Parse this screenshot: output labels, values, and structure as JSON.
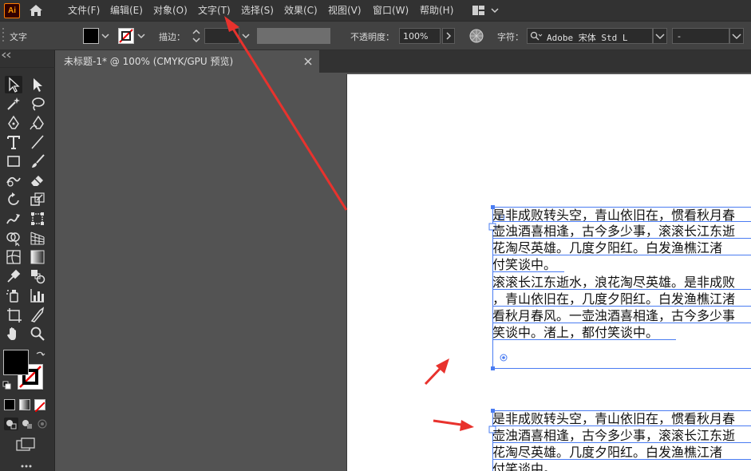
{
  "app": {
    "logo": "Ai"
  },
  "menu": [
    {
      "label": "文件(F)"
    },
    {
      "label": "编辑(E)"
    },
    {
      "label": "对象(O)"
    },
    {
      "label": "文字(T)"
    },
    {
      "label": "选择(S)"
    },
    {
      "label": "效果(C)"
    },
    {
      "label": "视图(V)"
    },
    {
      "label": "窗口(W)"
    },
    {
      "label": "帮助(H)"
    }
  ],
  "control": {
    "tool_name": "文字",
    "stroke_label": "描边：",
    "opacity_label": "不透明度：",
    "opacity_value": "100%",
    "char_label": "字符：",
    "font_value": "Adobe 宋体 Std L",
    "style_value": "-"
  },
  "tab": {
    "title": "未标题-1* @ 100% (CMYK/GPU 预览)"
  },
  "text_blocks": {
    "block1": [
      "是非成败转头空，青山依旧在，惯看秋月春",
      "壶浊酒喜相逢，古今多少事，滚滚长江东逝",
      "花淘尽英雄。几度夕阳红。白发渔樵江渚",
      "付笑谈中。",
      "滚滚长江东逝水，浪花淘尽英雄。是非成败",
      "，青山依旧在，几度夕阳红。白发渔樵江渚",
      "看秋月春风。一壶浊酒喜相逢，古今多少事",
      "笑谈中。渚上，都付笑谈中。"
    ],
    "block2": [
      "是非成败转头空，青山依旧在，惯看秋月春",
      "壶浊酒喜相逢，古今多少事，滚滚长江东逝",
      "花淘尽英雄。几度夕阳红。白发渔樵江渚",
      "付笑谈中。"
    ]
  },
  "colors": {
    "accent": "#4a7cf2",
    "arrow": "#e8322d",
    "app_orange": "#ff7c00"
  }
}
